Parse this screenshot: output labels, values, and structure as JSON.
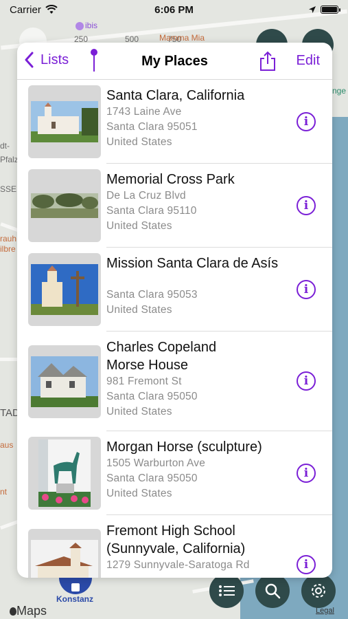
{
  "status_bar": {
    "carrier": "Carrier",
    "time": "6:06 PM"
  },
  "map": {
    "labels": [
      "ibis",
      "250",
      "500",
      "750",
      "Mamma Mia",
      "Konstanz",
      "dt-",
      "Pfalz",
      "SSE",
      "rauh",
      "ilbre",
      "TAD",
      "aus",
      "nt",
      "nge"
    ],
    "scale": [
      "0",
      "250",
      "500",
      "750 ft"
    ]
  },
  "panel": {
    "back_label": "Lists",
    "title": "My Places",
    "edit_label": "Edit",
    "places": [
      {
        "title_lines": [
          "Santa Clara, California"
        ],
        "address": [
          "1743 Laine Ave",
          "Santa Clara 95051",
          "United States"
        ]
      },
      {
        "title_lines": [
          "Memorial Cross Park"
        ],
        "address": [
          "De La Cruz Blvd",
          "Santa Clara 95110",
          "United States"
        ]
      },
      {
        "title_lines": [
          "Mission Santa Clara de Asís"
        ],
        "address": [
          "",
          "Santa Clara 95053",
          "United States"
        ]
      },
      {
        "title_lines": [
          "Charles Copeland",
          "Morse House"
        ],
        "address": [
          "981 Fremont St",
          "Santa Clara 95050",
          "United States"
        ]
      },
      {
        "title_lines": [
          "Morgan Horse (sculpture)"
        ],
        "address": [
          "1505 Warburton Ave",
          "Santa Clara 95050",
          "United States"
        ]
      },
      {
        "title_lines": [
          "Fremont High School",
          "(Sunnyvale, California)"
        ],
        "address": [
          "1279 Sunnyvale-Saratoga Rd"
        ]
      }
    ]
  },
  "footer": {
    "maps_label": "Maps",
    "legal_label": "Legal",
    "city_label": "Konstanz"
  },
  "icons": [
    "wifi-icon",
    "location-arrow-icon",
    "battery-icon",
    "chevron-left-icon",
    "pin-icon",
    "share-icon",
    "info-icon",
    "list-icon",
    "search-icon",
    "gear-icon",
    "compass-icon",
    "apple-icon"
  ],
  "colors": {
    "accent": "#7a1fd6",
    "fab": "#2f4a4a",
    "water": "#7ea9bf"
  }
}
